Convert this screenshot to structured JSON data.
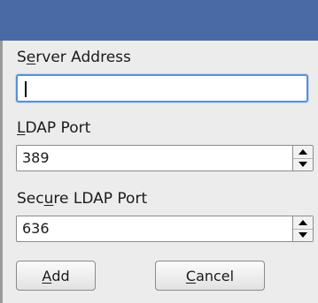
{
  "dialog": {
    "server_address": {
      "label_pre": "S",
      "label_mn": "e",
      "label_post": "rver Address",
      "value": ""
    },
    "ldap_port": {
      "label_pre": "",
      "label_mn": "L",
      "label_post": "DAP Port",
      "value": "389"
    },
    "secure_ldap_port": {
      "label_pre": "Sec",
      "label_mn": "u",
      "label_post": "re LDAP Port",
      "value": "636"
    },
    "buttons": {
      "add": {
        "pre": "",
        "mn": "A",
        "post": "dd"
      },
      "cancel": {
        "pre": "",
        "mn": "C",
        "post": "ancel"
      }
    }
  }
}
